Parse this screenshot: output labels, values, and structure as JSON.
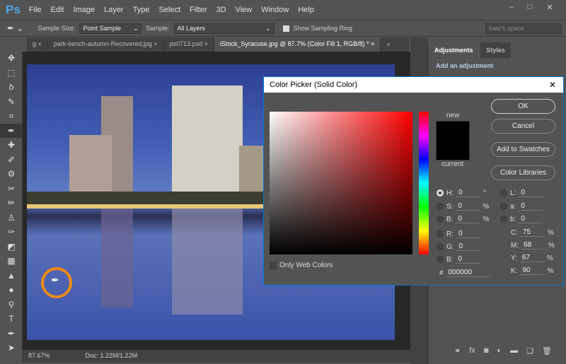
{
  "app": {
    "logo": "Ps",
    "menus": [
      "File",
      "Edit",
      "Image",
      "Layer",
      "Type",
      "Select",
      "Filter",
      "3D",
      "View",
      "Window",
      "Help"
    ],
    "win_buttons": [
      "–",
      "□",
      "✕"
    ]
  },
  "options": {
    "sample_size_label": "Sample Size:",
    "sample_size": "Point Sample",
    "sample_label": "Sample:",
    "sample": "All Layers",
    "show_ring": "Show Sampling Ring",
    "workspace": "kate's space"
  },
  "tabs": [
    {
      "label": "g ×"
    },
    {
      "label": "park-bench-autumn-Recovered.jpg ×"
    },
    {
      "label": "ps0713.psd ×"
    },
    {
      "label": "iStock_Syracuse.jpg @ 87.7% (Color Fill 1, RGB/8) * ×"
    }
  ],
  "tabs_overflow": "»",
  "status": {
    "zoom": "87.67%",
    "doc": "Doc: 1.22M/1.22M"
  },
  "panel": {
    "tabs": [
      "Adjustments",
      "Styles"
    ],
    "heading": "Add an adjustment"
  },
  "dialog": {
    "title": "Color Picker (Solid Color)",
    "close": "✕",
    "new_label": "new",
    "current_label": "current",
    "new_color": "#000000",
    "buttons": {
      "ok": "OK",
      "cancel": "Cancel",
      "swatches": "Add to Swatches",
      "libraries": "Color Libraries"
    },
    "only_web": "Only Web Colors",
    "fields": {
      "H": {
        "label": "H:",
        "value": "0",
        "unit": "°"
      },
      "S": {
        "label": "S:",
        "value": "0",
        "unit": "%"
      },
      "Bv": {
        "label": "B:",
        "value": "0",
        "unit": "%"
      },
      "R": {
        "label": "R:",
        "value": "0"
      },
      "G": {
        "label": "G:",
        "value": "0"
      },
      "B": {
        "label": "B:",
        "value": "0"
      },
      "L": {
        "label": "L:",
        "value": "0"
      },
      "a": {
        "label": "a:",
        "value": "0"
      },
      "b": {
        "label": "b:",
        "value": "0"
      },
      "C": {
        "label": "C:",
        "value": "75",
        "unit": "%"
      },
      "M": {
        "label": "M:",
        "value": "68",
        "unit": "%"
      },
      "Y": {
        "label": "Y:",
        "value": "67",
        "unit": "%"
      },
      "K": {
        "label": "K:",
        "value": "90",
        "unit": "%"
      },
      "hex": {
        "label": "#",
        "value": "000000"
      }
    }
  }
}
